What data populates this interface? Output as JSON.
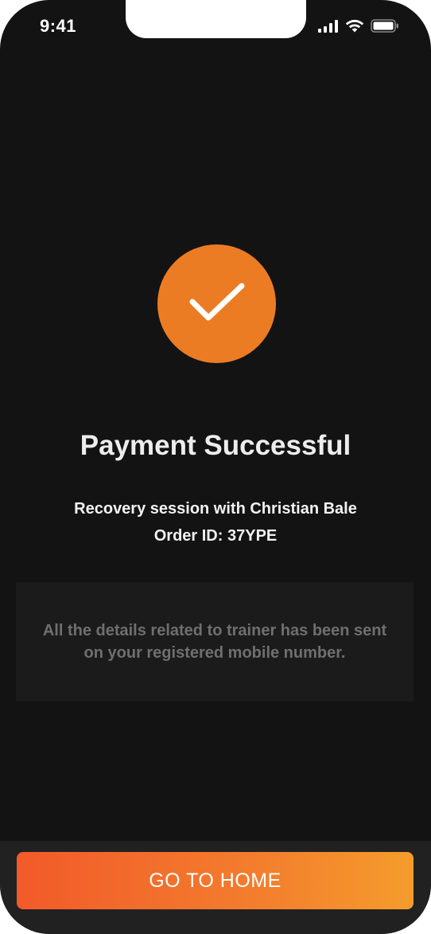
{
  "status_bar": {
    "time": "9:41",
    "icons": [
      "cellular-signal-icon",
      "wifi-icon",
      "battery-icon"
    ]
  },
  "colors": {
    "background": "#131313",
    "accent": "#ec7c23",
    "button_gradient_start": "#f25a2a",
    "button_gradient_end": "#f49c2c",
    "info_box": "#1b1b1b",
    "muted_text": "#6f6f6f"
  },
  "success_icon": "checkmark-icon",
  "main": {
    "title": "Payment Successful",
    "session": "Recovery session with Christian Bale",
    "order_label": "Order ID:",
    "order_id": "37YPE",
    "info_line1": "All the details related to trainer has been sent",
    "info_line2": "on your registered mobile number."
  },
  "footer": {
    "button_label": "GO TO HOME"
  }
}
